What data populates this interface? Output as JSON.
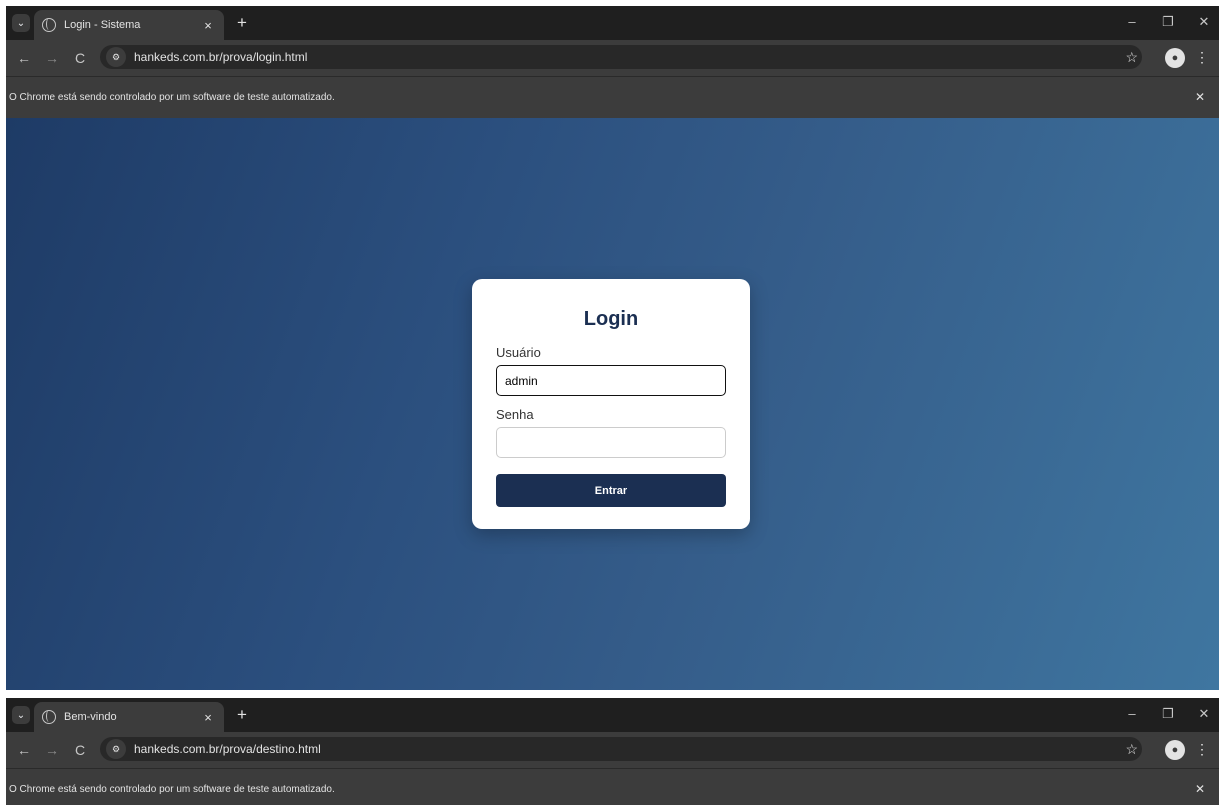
{
  "window1": {
    "tab_title": "Login - Sistema",
    "url": "hankeds.com.br/prova/login.html",
    "infobar_text": "O Chrome está sendo controlado por um software de teste automatizado.",
    "login": {
      "title": "Login",
      "user_label": "Usuário",
      "user_value": "admin",
      "password_label": "Senha",
      "password_value": "",
      "submit_label": "Entrar"
    }
  },
  "window2": {
    "tab_title": "Bem-vindo",
    "url": "hankeds.com.br/prova/destino.html",
    "infobar_text": "O Chrome está sendo controlado por um software de teste automatizado."
  },
  "chrome": {
    "tab_close": "×",
    "new_tab": "+",
    "minimize": "–",
    "restore": "❐",
    "close": "✕",
    "back": "←",
    "forward": "→",
    "reload": "C",
    "star": "☆",
    "menu": "⋮",
    "infobar_close": "✕",
    "tab_search": "⌄"
  },
  "colors": {
    "accent": "#1b2f52",
    "background_start": "#1e3b66",
    "background_end": "#3f76a0"
  }
}
